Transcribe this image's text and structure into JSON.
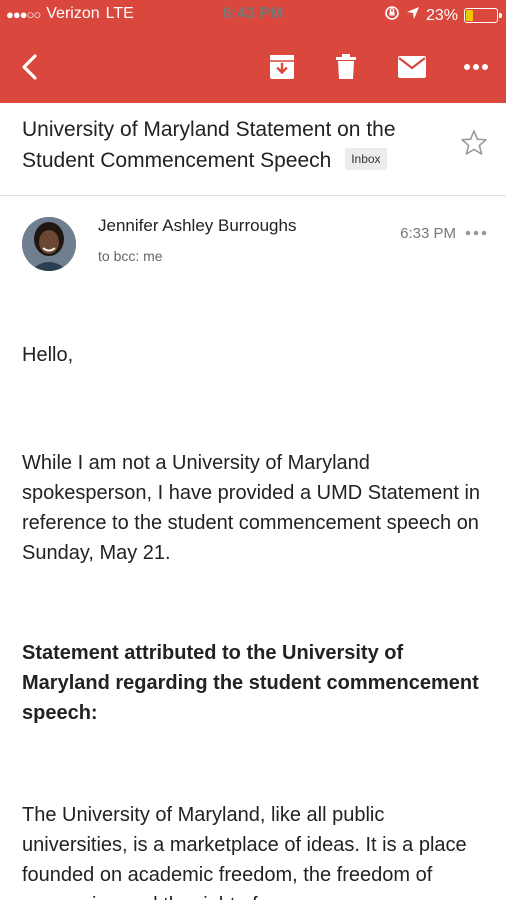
{
  "status_bar": {
    "signal_dots": "●●●○○",
    "carrier": "Verizon",
    "network": "LTE",
    "time": "6:43 PM",
    "battery": "23%",
    "battery_level": 0.23
  },
  "toolbar": {
    "back_icon": "chevron-left-icon",
    "archive_icon": "archive-icon",
    "delete_icon": "trash-icon",
    "mail_icon": "envelope-icon",
    "more_icon": "more-horizontal-icon"
  },
  "email": {
    "subject": "University of Maryland Statement on the Student Commencement Speech",
    "label": "Inbox",
    "sender": "Jennifer Ashley Burroughs",
    "recipients": "to bcc: me",
    "time": "6:33 PM",
    "body": {
      "greeting": "Hello,",
      "intro": "While I am not a University of Maryland spokesperson, I have provided a UMD Statement in reference to the student commencement speech on Sunday, May 21.",
      "heading": "Statement attributed to the University of Maryland regarding the student commencement speech:",
      "statement": "The University of Maryland, like all public universities, is a marketplace of ideas. It is a place founded on academic freedom, the freedom of expression and the right of"
    }
  },
  "colors": {
    "header": "#d9473d",
    "battery_fill": "#f5c400"
  }
}
